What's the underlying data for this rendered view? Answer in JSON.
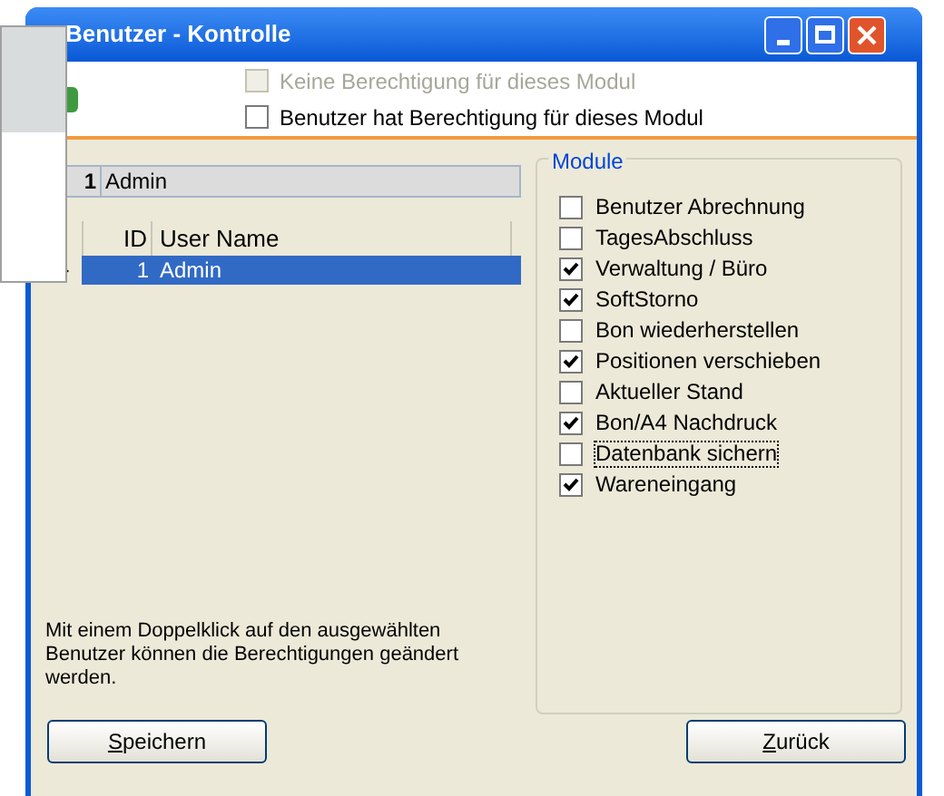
{
  "window": {
    "title": "Benutzer - Kontrolle"
  },
  "legend": [
    {
      "label": "Keine Berechtigung für dieses Modul",
      "checked": false,
      "disabled": true
    },
    {
      "label": "Benutzer hat Berechtigung für dieses Modul",
      "checked": false,
      "disabled": false
    }
  ],
  "current_user": {
    "id": "1",
    "name": "Admin"
  },
  "table": {
    "columns": [
      "ID",
      "User Name"
    ],
    "rows": [
      {
        "id": "1",
        "name": "Admin",
        "selected": true
      }
    ]
  },
  "modules": {
    "title": "Module",
    "items": [
      {
        "label": "Benutzer Abrechnung",
        "checked": false,
        "focused": false
      },
      {
        "label": "TagesAbschluss",
        "checked": false,
        "focused": false
      },
      {
        "label": "Verwaltung / Büro",
        "checked": true,
        "focused": false
      },
      {
        "label": "SoftStorno",
        "checked": true,
        "focused": false
      },
      {
        "label": "Bon wiederherstellen",
        "checked": false,
        "focused": false
      },
      {
        "label": "Positionen verschieben",
        "checked": true,
        "focused": false
      },
      {
        "label": "Aktueller Stand",
        "checked": false,
        "focused": false
      },
      {
        "label": "Bon/A4 Nachdruck",
        "checked": true,
        "focused": false
      },
      {
        "label": "Datenbank sichern",
        "checked": false,
        "focused": true
      },
      {
        "label": "Wareneingang",
        "checked": true,
        "focused": false
      }
    ]
  },
  "hint": "Mit einem Doppelklick auf den ausgewählten Benutzer können die Berechtigungen geändert werden.",
  "buttons": [
    "Speichern",
    "Zurück"
  ]
}
